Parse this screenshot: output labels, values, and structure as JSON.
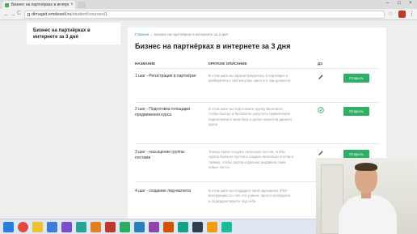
{
  "browser": {
    "tab_title": "Бизнес на партнёрках в интерн",
    "tab_close": "×",
    "url_host": "dimagid.emdesell.ru",
    "url_path": "/student/courses/1",
    "nav_back": "←",
    "nav_forward": "→",
    "nav_reload": "C",
    "star": "☆",
    "menu": "⋮",
    "win_min": "–",
    "win_max": "□",
    "win_close": "×"
  },
  "sidebar": {
    "course_name": "Бизнес на партнёрках в интернете за 3 дня"
  },
  "main": {
    "breadcrumb_home": "Главная",
    "breadcrumb_sep": " → ",
    "breadcrumb_current": "Бизнес на партнёрках в интернете за 3 дня",
    "title": "Бизнес на партнёрках в интернете за 3 дня",
    "columns": {
      "name": "НАЗВАНИЕ",
      "desc": "КРАТКОЕ ОПИСАНИЕ",
      "hw": "ДЗ"
    },
    "lessons": [
      {
        "name": "1 шаг - Регистрация в партнёрке",
        "desc": "В этом шаге вы зарегистрируетесь в партнёрке и разберётесь с ней изнутри, как и кто там делается.",
        "hw_icon": "pencil-icon",
        "button": "Открыть"
      },
      {
        "name": "2 шаг - Подготовка площадки продвижения курса",
        "desc": "В этом шаге вы подготовите группу Вконтакте, чтобы быстро и бесплатно запустить привлечение подписчиков в свою базу и далее клиентов данного курса.",
        "hw_icon": "check-circle-icon",
        "button": "Открыть"
      },
      {
        "name": "3 шаг - насыщение группы постами",
        "desc": "Теперь нужно создать несколько постов, чтобы группа была не пустой и создать несколько постов в таймер, чтобы группа и дальше выдавала сама новые посты.",
        "hw_icon": "pencil-icon",
        "button": "Открыть"
      },
      {
        "name": "4 шаг - создание лид-магнита",
        "desc": "В этом шаге вы создадите свой лид-магнит (PDF-инструкцию) по той, что у меня, просто скопируете и подкорректируете под себя.",
        "hw_icon": "",
        "button": ""
      }
    ]
  },
  "colors": {
    "accent_green": "#2fae66",
    "link_blue": "#3a8bbb"
  },
  "taskbar": {
    "icons": [
      "windows-start-icon",
      "chrome-icon",
      "folder-icon",
      "mail-icon",
      "media-icon",
      "browser-icon",
      "app-icon",
      "app-icon",
      "app-icon",
      "app-icon",
      "app-icon",
      "app-icon",
      "app-icon",
      "app-icon",
      "app-icon",
      "app-icon"
    ]
  }
}
